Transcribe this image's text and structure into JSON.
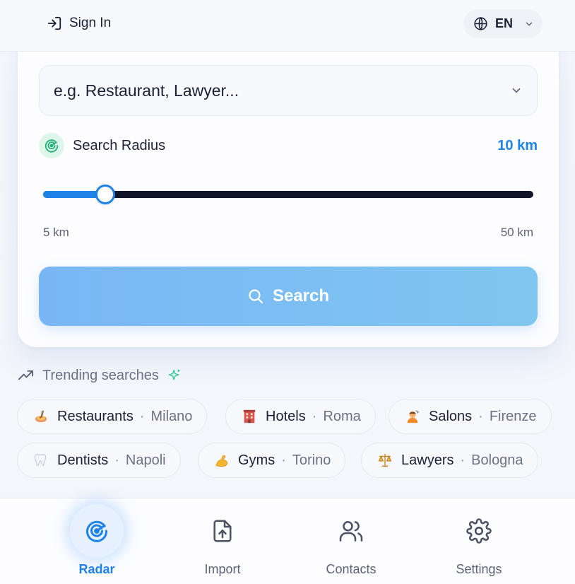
{
  "header": {
    "sign_in_label": "Sign In",
    "language": "EN"
  },
  "form": {
    "business_type_placeholder": "e.g. Restaurant, Lawyer...",
    "radius_label": "Search Radius",
    "radius_value": "10 km",
    "radius_min_label": "5 km",
    "radius_max_label": "50 km",
    "radius_min": 5,
    "radius_max": 50,
    "radius_current": 10,
    "search_label": "Search"
  },
  "trending": {
    "title": "Trending searches",
    "items": [
      {
        "category": "Restaurants",
        "city": "Milano",
        "icon": "spaghetti-icon"
      },
      {
        "category": "Hotels",
        "city": "Roma",
        "icon": "hotel-icon"
      },
      {
        "category": "Salons",
        "city": "Firenze",
        "icon": "haircut-icon"
      },
      {
        "category": "Dentists",
        "city": "Napoli",
        "icon": "tooth-icon"
      },
      {
        "category": "Gyms",
        "city": "Torino",
        "icon": "flexed-biceps-icon"
      },
      {
        "category": "Lawyers",
        "city": "Bologna",
        "icon": "scales-icon"
      }
    ]
  },
  "nav": {
    "items": [
      {
        "label": "Radar",
        "icon": "radar-icon",
        "active": true
      },
      {
        "label": "Import",
        "icon": "file-upload-icon",
        "active": false
      },
      {
        "label": "Contacts",
        "icon": "users-icon",
        "active": false
      },
      {
        "label": "Settings",
        "icon": "gear-icon",
        "active": false
      }
    ]
  },
  "colors": {
    "accent": "#1e83e6",
    "track": "#0e1628",
    "search_button": "#7ab6f6",
    "radius_icon_bg": "#def6ea",
    "radius_icon": "#22b07a",
    "sparkle": "#3fcf9a"
  }
}
